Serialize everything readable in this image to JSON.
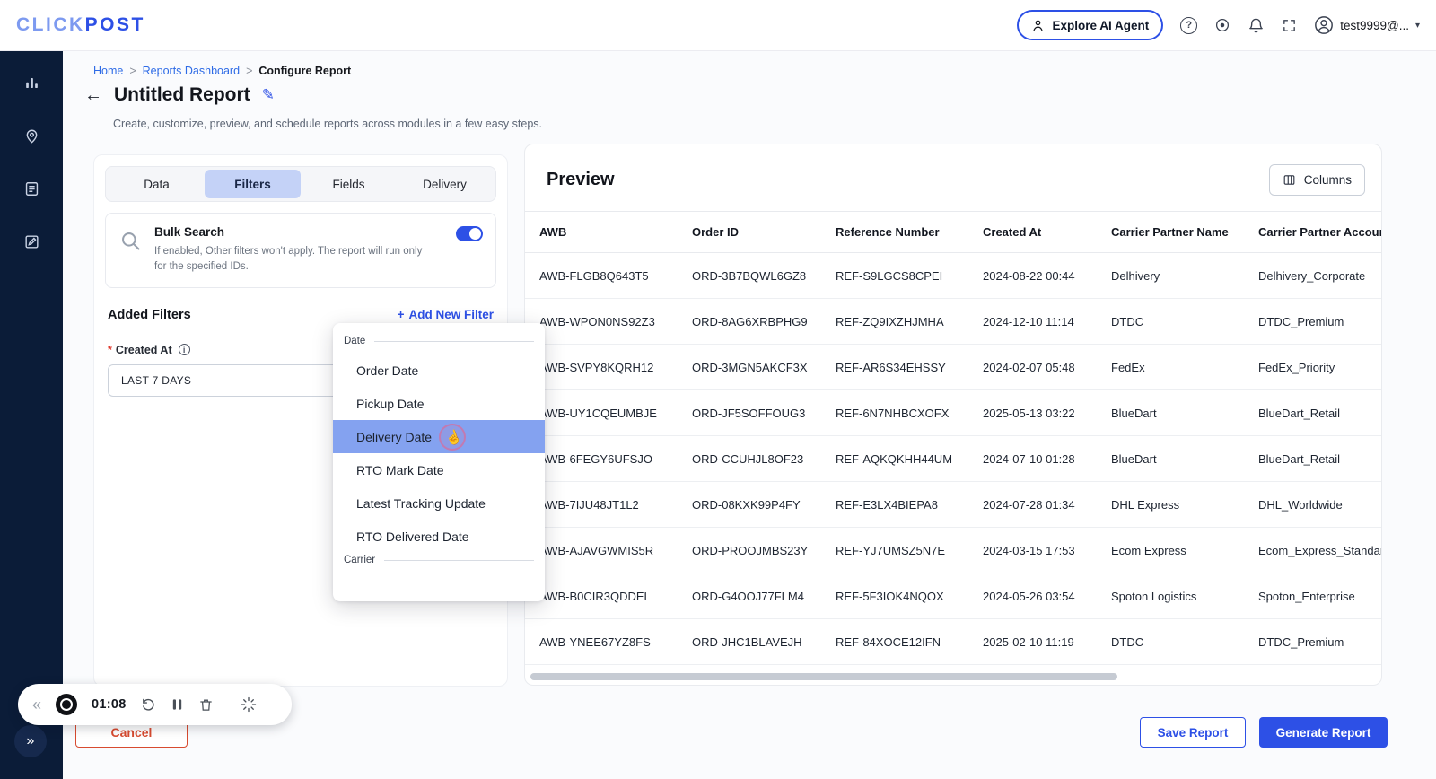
{
  "header": {
    "logo_primary": "CLICK",
    "logo_secondary": "POST",
    "ai_button_label": "Explore AI Agent",
    "username": "test9999@...",
    "help_glyph": "?"
  },
  "icons": {
    "breadcrumb_separator": ">",
    "back_arrow": "←",
    "edit_pencil": "✎",
    "plus": "+",
    "chevron_down": "▾",
    "double_chevron_left": "«",
    "double_chevron_right": "»",
    "hand_cursor": "☝",
    "info": "i",
    "required_asterisk": "*"
  },
  "breadcrumb": {
    "items": [
      "Home",
      "Reports Dashboard",
      "Configure Report"
    ]
  },
  "page": {
    "title": "Untitled Report",
    "subtitle": "Create, customize, preview, and schedule reports across modules in a few easy steps."
  },
  "tabs": {
    "items": [
      {
        "label": "Data",
        "active": false
      },
      {
        "label": "Filters",
        "active": true
      },
      {
        "label": "Fields",
        "active": false
      },
      {
        "label": "Delivery",
        "active": false
      }
    ]
  },
  "bulk_search": {
    "title": "Bulk Search",
    "description": "If enabled, Other filters won't apply. The report will run only for the specified IDs.",
    "enabled": true
  },
  "filters": {
    "section_title": "Added Filters",
    "add_new_label": "Add New Filter",
    "created_at_label": "Created At",
    "created_at_value": "LAST 7 DAYS"
  },
  "filter_menu": {
    "highlighted_item": "Delivery Date",
    "sections": [
      {
        "label": "Date",
        "items": [
          "Order Date",
          "Pickup Date",
          "Delivery Date",
          "RTO Mark Date",
          "Latest Tracking Update",
          "RTO Delivered Date"
        ]
      },
      {
        "label": "Carrier",
        "items": []
      }
    ]
  },
  "preview": {
    "title": "Preview",
    "columns_button_label": "Columns",
    "table": {
      "headers": [
        "AWB",
        "Order ID",
        "Reference Number",
        "Created At",
        "Carrier Partner Name",
        "Carrier Partner Account"
      ],
      "rows": [
        [
          "AWB-FLGB8Q643T5",
          "ORD-3B7BQWL6GZ8",
          "REF-S9LGCS8CPEI",
          "2024-08-22 00:44",
          "Delhivery",
          "Delhivery_Corporate"
        ],
        [
          "AWB-WPON0NS92Z3",
          "ORD-8AG6XRBPHG9",
          "REF-ZQ9IXZHJMHA",
          "2024-12-10 11:14",
          "DTDC",
          "DTDC_Premium"
        ],
        [
          "AWB-SVPY8KQRH12",
          "ORD-3MGN5AKCF3X",
          "REF-AR6S34EHSSY",
          "2024-02-07 05:48",
          "FedEx",
          "FedEx_Priority"
        ],
        [
          "AWB-UY1CQEUMBJE",
          "ORD-JF5SOFFOUG3",
          "REF-6N7NHBCXOFX",
          "2025-05-13 03:22",
          "BlueDart",
          "BlueDart_Retail"
        ],
        [
          "AWB-6FEGY6UFSJO",
          "ORD-CCUHJL8OF23",
          "REF-AQKQKHH44UM",
          "2024-07-10 01:28",
          "BlueDart",
          "BlueDart_Retail"
        ],
        [
          "AWB-7IJU48JT1L2",
          "ORD-08KXK99P4FY",
          "REF-E3LX4BIEPA8",
          "2024-07-28 01:34",
          "DHL Express",
          "DHL_Worldwide"
        ],
        [
          "AWB-AJAVGWMIS5R",
          "ORD-PROOJMBS23Y",
          "REF-YJ7UMSZ5N7E",
          "2024-03-15 17:53",
          "Ecom Express",
          "Ecom_Express_Standard"
        ],
        [
          "AWB-B0CIR3QDDEL",
          "ORD-G4OOJ77FLM4",
          "REF-5F3IOK4NQOX",
          "2024-05-26 03:54",
          "Spoton Logistics",
          "Spoton_Enterprise"
        ],
        [
          "AWB-YNEE67YZ8FS",
          "ORD-JHC1BLAVEJH",
          "REF-84XOCE12IFN",
          "2025-02-10 11:19",
          "DTDC",
          "DTDC_Premium"
        ]
      ]
    }
  },
  "recorder": {
    "time": "01:08"
  },
  "footer": {
    "cancel_label": "Cancel",
    "save_label": "Save Report",
    "generate_label": "Generate Report"
  }
}
